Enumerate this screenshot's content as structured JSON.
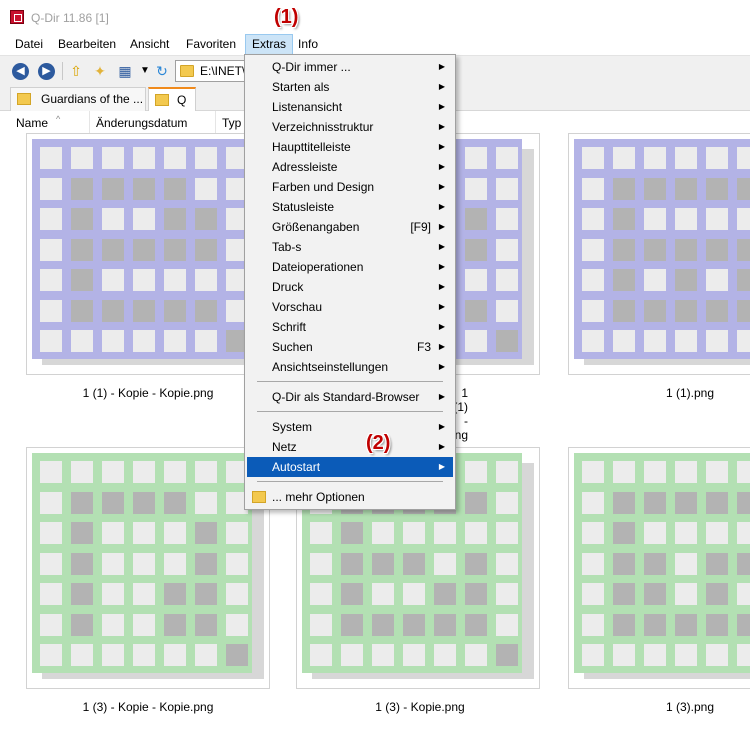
{
  "window": {
    "title": "Q-Dir 11.86 [1]"
  },
  "menubar": [
    {
      "label": "Datei",
      "active": false
    },
    {
      "label": "Bearbeiten",
      "active": false
    },
    {
      "label": "Ansicht",
      "active": false
    },
    {
      "label": "Favoriten",
      "active": false
    },
    {
      "label": "Extras",
      "active": true
    },
    {
      "label": "Info",
      "active": false
    }
  ],
  "toolbar": {
    "back_icon": "back-icon",
    "forward_icon": "forward-icon",
    "up_icon": "folder-up-icon",
    "new_folder_icon": "new-folder-icon",
    "view_icon": "view-mode-icon",
    "refresh_icon": "refresh-icon",
    "address": "E:\\INET\\S"
  },
  "tabs": [
    {
      "label": "Guardians of the ...",
      "active": false
    },
    {
      "label": "Q",
      "active": true
    }
  ],
  "columns": [
    "Name",
    "Änderungsdatum",
    "Typ"
  ],
  "files": [
    {
      "name": "1 (1) - Kopie - Kopie.png",
      "color": "#b3b3e6"
    },
    {
      "name": "1 (1) - Kopie.png",
      "color": "#b3b3e6"
    },
    {
      "name": "1 (1).png",
      "color": "#b3b3e6"
    },
    {
      "name": "1 (3) - Kopie - Kopie.png",
      "color": "#b3e0b3"
    },
    {
      "name": "1 (3) - Kopie.png",
      "color": "#b3e0b3"
    },
    {
      "name": "1 (3).png",
      "color": "#b3e0b3"
    }
  ],
  "menu": {
    "items": [
      {
        "label": "Q-Dir immer ...",
        "shortcut": "",
        "submenu": true,
        "highlighted": false
      },
      {
        "label": "Starten als",
        "shortcut": "",
        "submenu": true,
        "highlighted": false
      },
      {
        "label": "Listenansicht",
        "shortcut": "",
        "submenu": true,
        "highlighted": false
      },
      {
        "label": "Verzeichnisstruktur",
        "shortcut": "",
        "submenu": true,
        "highlighted": false
      },
      {
        "label": "Haupttitelleiste",
        "shortcut": "",
        "submenu": true,
        "highlighted": false
      },
      {
        "label": "Adressleiste",
        "shortcut": "",
        "submenu": true,
        "highlighted": false
      },
      {
        "label": "Farben und Design",
        "shortcut": "",
        "submenu": true,
        "highlighted": false
      },
      {
        "label": "Statusleiste",
        "shortcut": "",
        "submenu": true,
        "highlighted": false
      },
      {
        "label": "Größenangaben",
        "shortcut": "[F9]",
        "submenu": true,
        "highlighted": false
      },
      {
        "label": "Tab-s",
        "shortcut": "",
        "submenu": true,
        "highlighted": false
      },
      {
        "label": "Dateioperationen",
        "shortcut": "",
        "submenu": true,
        "highlighted": false
      },
      {
        "label": "Druck",
        "shortcut": "",
        "submenu": true,
        "highlighted": false
      },
      {
        "label": "Vorschau",
        "shortcut": "",
        "submenu": true,
        "highlighted": false
      },
      {
        "label": "Schrift",
        "shortcut": "",
        "submenu": true,
        "highlighted": false
      },
      {
        "label": "Suchen",
        "shortcut": "F3",
        "submenu": true,
        "highlighted": false
      },
      {
        "label": "Ansichtseinstellungen",
        "shortcut": "",
        "submenu": true,
        "highlighted": false
      },
      {
        "label": "Q-Dir als Standard-Browser",
        "shortcut": "",
        "submenu": true,
        "highlighted": false
      },
      {
        "label": "System",
        "shortcut": "",
        "submenu": true,
        "highlighted": false
      },
      {
        "label": "Netz",
        "shortcut": "",
        "submenu": true,
        "highlighted": false
      },
      {
        "label": "Autostart",
        "shortcut": "",
        "submenu": true,
        "highlighted": true
      },
      {
        "label": "... mehr Optionen",
        "shortcut": "",
        "submenu": false,
        "highlighted": false
      }
    ],
    "more_icon": "folder-icon"
  },
  "markers": [
    "(1)",
    "(2)"
  ],
  "colors": {
    "highlight": "#0b5bb8",
    "marker": "#c00000",
    "tab_accent": "#f08a1c"
  }
}
